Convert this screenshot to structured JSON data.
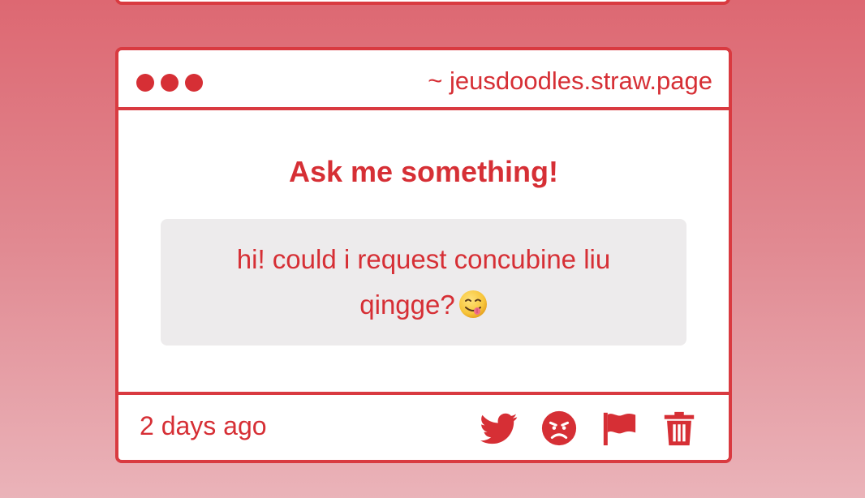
{
  "card": {
    "url": "~ jeusdoodles.straw.page",
    "heading": "Ask me something!",
    "question": "hi! could i request concubine liu qingge?",
    "question_emoji": "face-savoring-food-emoji",
    "timestamp": "2 days ago"
  },
  "icons": {
    "window_dots": [
      "dot-icon",
      "dot-icon",
      "dot-icon"
    ],
    "actions": [
      "twitter-icon",
      "angry-face-icon",
      "flag-icon",
      "trash-icon"
    ]
  },
  "colors": {
    "accent": "#d62f35",
    "border": "#d93a40",
    "question_bg": "#edebec",
    "background_top": "#dd6872",
    "background_bottom": "#eab3b9"
  }
}
